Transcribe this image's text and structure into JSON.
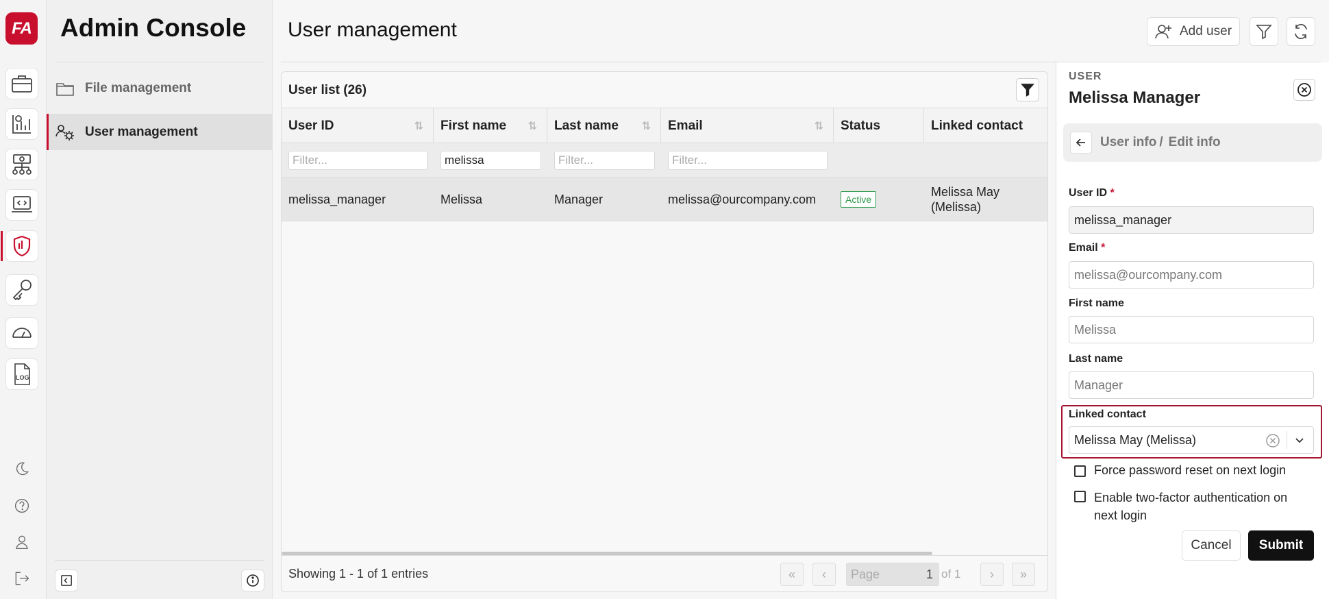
{
  "app": {
    "logo_text": "FA",
    "title": "Admin Console"
  },
  "sidebar": {
    "items": [
      {
        "label": "File management",
        "icon": "folder-icon"
      },
      {
        "label": "User management",
        "icon": "users-gear-icon"
      }
    ]
  },
  "rail": {
    "icons": [
      "briefcase-icon",
      "report-icon",
      "hierarchy-icon",
      "code-laptop-icon",
      "shield-icon",
      "key-icon",
      "gauge-icon",
      "log-icon",
      "moon-icon",
      "help-icon",
      "user-icon",
      "logout-icon"
    ],
    "log_text": "LOG"
  },
  "header": {
    "title": "User management",
    "add_user_label": "Add user"
  },
  "table": {
    "title": "User list (26)",
    "columns": [
      "User ID",
      "First name",
      "Last name",
      "Email",
      "Status",
      "Linked contact"
    ],
    "filters": {
      "placeholder": "Filter...",
      "first_name": "melissa"
    },
    "rows": [
      {
        "user_id": "melissa_manager",
        "first_name": "Melissa",
        "last_name": "Manager",
        "email": "melissa@ourcompany.com",
        "status": "Active",
        "linked_contact": "Melissa May (Melissa)"
      }
    ],
    "footer": {
      "showing": "Showing 1 - 1 of 1 entries",
      "page_label": "Page",
      "page": "1",
      "of": "of 1"
    }
  },
  "panel": {
    "label": "USER",
    "name": "Melissa Manager",
    "breadcrumb": [
      "User info",
      "/",
      "Edit info"
    ],
    "fields": {
      "user_id_label": "User ID",
      "user_id": "melissa_manager",
      "email_label": "Email",
      "email": "melissa@ourcompany.com",
      "first_name_label": "First name",
      "first_name": "Melissa",
      "last_name_label": "Last name",
      "last_name": "Manager",
      "linked_contact_label": "Linked contact",
      "linked_contact": "Melissa May (Melissa)",
      "required_mark": "*"
    },
    "checkboxes": {
      "force_reset": "Force password reset on next login",
      "two_factor": "Enable two-factor authentication on next login"
    },
    "cancel_label": "Cancel",
    "submit_label": "Submit"
  },
  "colors": {
    "brand": "#c8102e",
    "active_badge": "#2e9a4a",
    "submit_bg": "#111111"
  }
}
